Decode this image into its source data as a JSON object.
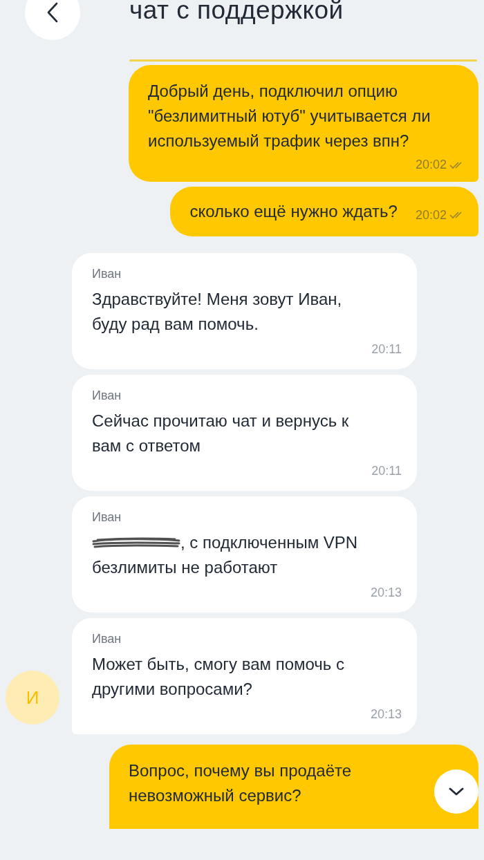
{
  "header": {
    "title": "чат с поддержкой"
  },
  "messages": [
    {
      "kind": "outgoing",
      "text": "Добрый день, подключил опцию \"безлимитный ютуб\" учитывается ли используемый трафик через впн?",
      "time": "20:02",
      "read": true,
      "time_inline": false
    },
    {
      "kind": "outgoing",
      "text": "сколько ещё нужно ждать?",
      "time": "20:02",
      "read": true,
      "time_inline": true
    },
    {
      "kind": "incoming",
      "author": "Иван",
      "text": "Здравствуйте! Меня зовут Иван, буду рад вам помочь.",
      "time": "20:11"
    },
    {
      "kind": "incoming",
      "author": "Иван",
      "text": "Сейчас прочитаю чат и вернусь к вам с ответом",
      "time": "20:11"
    },
    {
      "kind": "incoming",
      "author": "Иван",
      "text": ", с подключенным VPN безлимиты не работают",
      "time": "20:13",
      "redacted_prefix": true
    },
    {
      "kind": "incoming",
      "author": "Иван",
      "text": "Может быть, смогу вам помочь с другими вопросами?",
      "time": "20:13",
      "avatar": "И"
    },
    {
      "kind": "outgoing",
      "text": "Вопрос, почему вы продаёте невозможный сервис?",
      "cut": true
    }
  ]
}
